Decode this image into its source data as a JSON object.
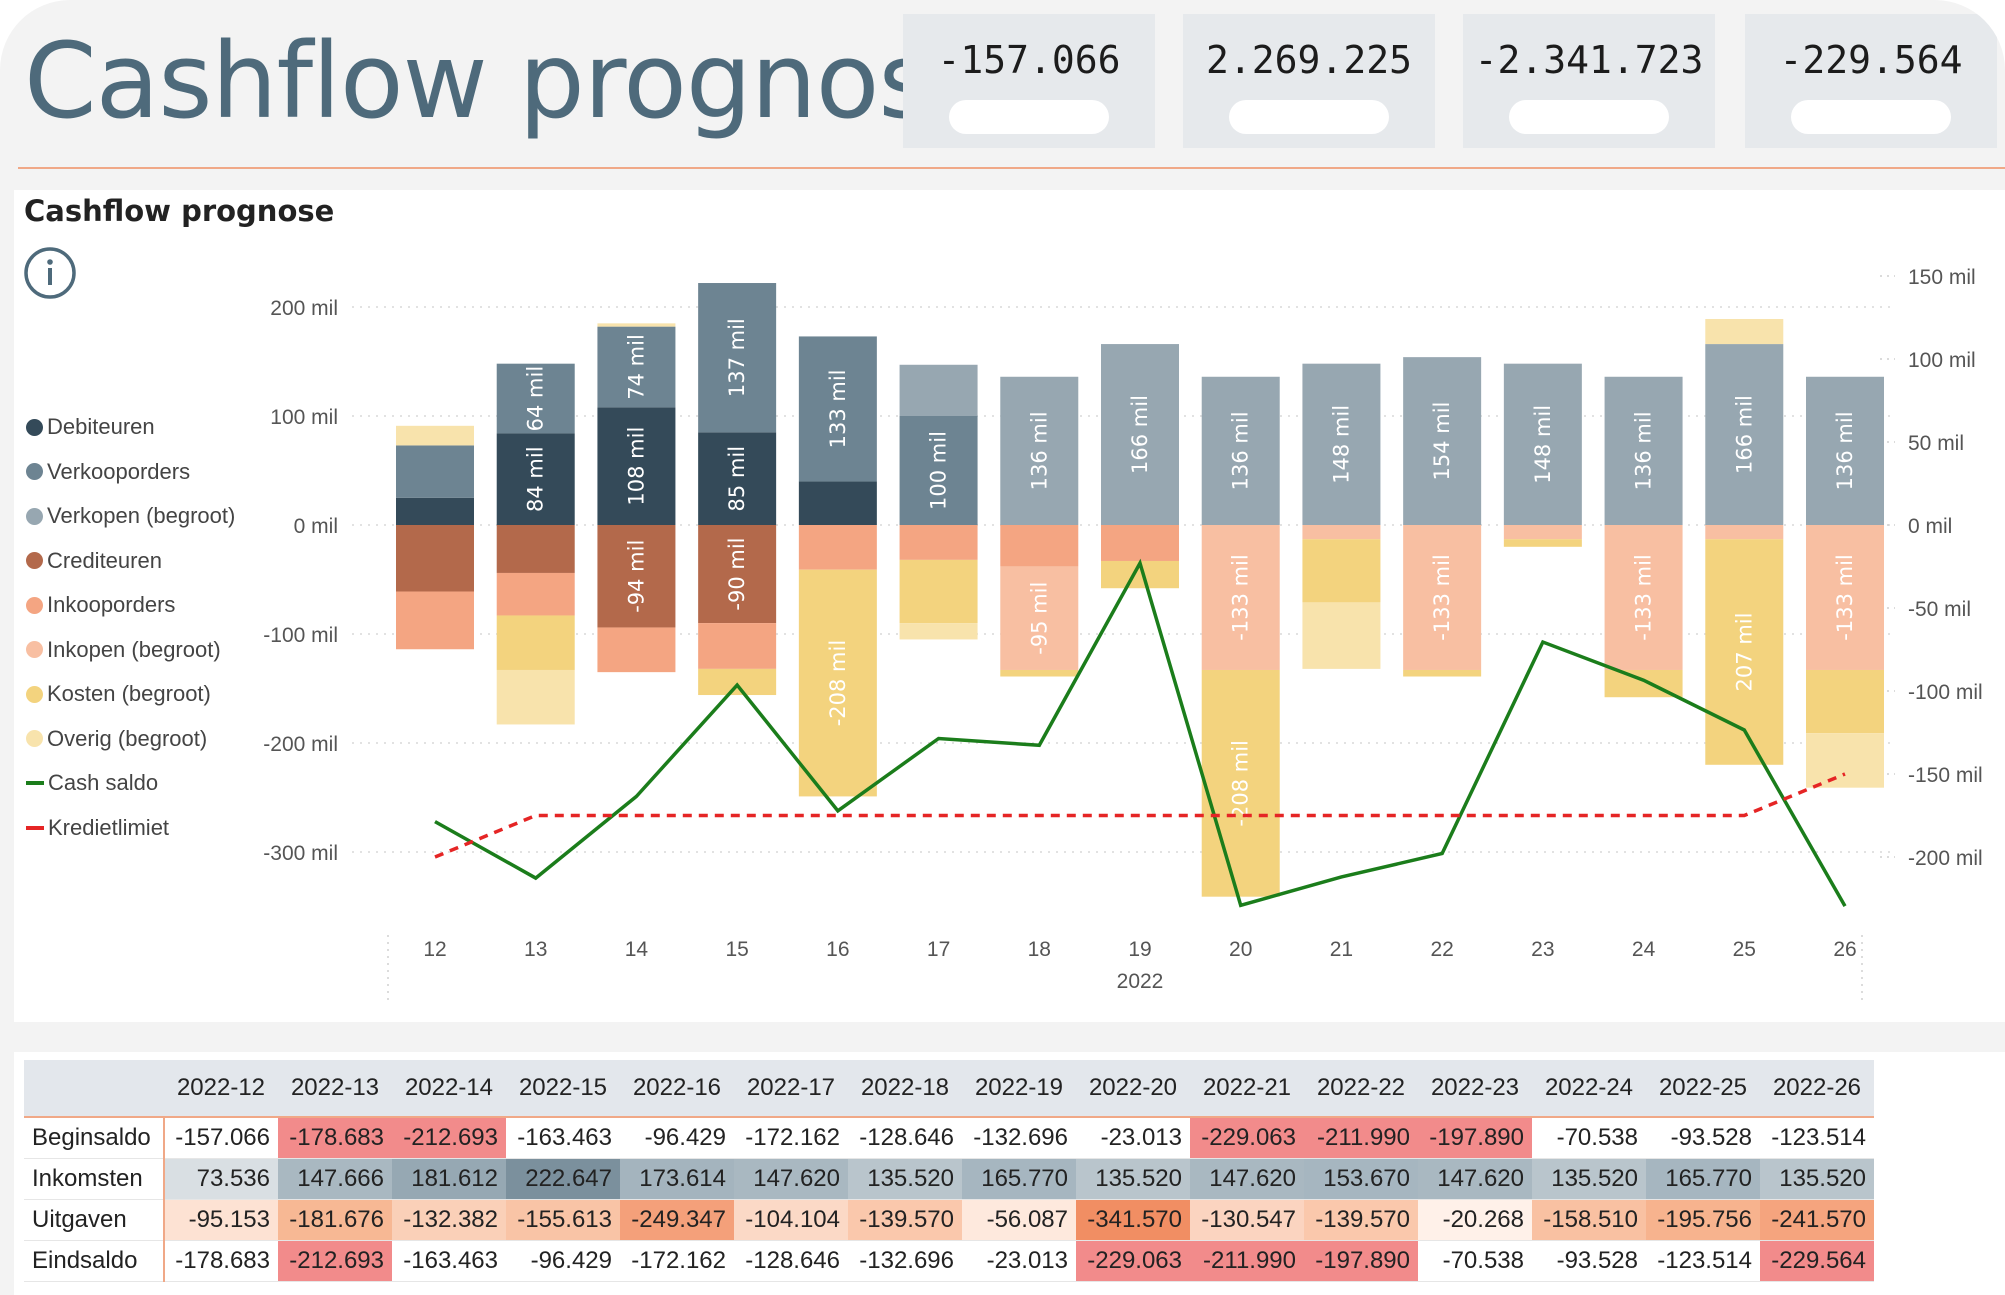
{
  "header": {
    "title": "Cashflow prognose",
    "kpis": [
      "-157.066",
      "2.269.225",
      "-2.341.723",
      "-229.564"
    ]
  },
  "chart_title": "Cashflow prognose",
  "chart_data": {
    "type": "bar",
    "stacked": true,
    "title": "Cashflow prognose",
    "year_label": "2022",
    "categories": [
      "12",
      "13",
      "14",
      "15",
      "16",
      "17",
      "18",
      "19",
      "20",
      "21",
      "22",
      "23",
      "24",
      "25",
      "26"
    ],
    "left_axis": {
      "ylim": [
        -350,
        230
      ],
      "ticks": [
        200,
        100,
        0,
        -100,
        -200,
        -300
      ],
      "tick_labels": [
        "200 mil",
        "100 mil",
        "0 mil",
        "-100 mil",
        "-200 mil",
        "-300 mil"
      ]
    },
    "right_axis": {
      "ylim": [
        -265,
        170
      ],
      "ticks": [
        150,
        100,
        50,
        0,
        -50,
        -100,
        -150,
        -200
      ],
      "tick_labels": [
        "150 mil",
        "100 mil",
        "50 mil",
        "0 mil",
        "-50 mil",
        "-100 mil",
        "-150 mil",
        "-200 mil"
      ]
    },
    "legend": [
      {
        "name": "Debiteuren",
        "color": "#344a59",
        "kind": "dot"
      },
      {
        "name": "Verkooporders",
        "color": "#6d8492",
        "kind": "dot"
      },
      {
        "name": "Verkopen (begroot)",
        "color": "#97a7b1",
        "kind": "dot"
      },
      {
        "name": "Crediteuren",
        "color": "#b3694b",
        "kind": "dot"
      },
      {
        "name": "Inkooporders",
        "color": "#f4a582",
        "kind": "dot"
      },
      {
        "name": "Inkopen (begroot)",
        "color": "#f8bfa2",
        "kind": "dot"
      },
      {
        "name": "Kosten (begroot)",
        "color": "#f3d37e",
        "kind": "dot"
      },
      {
        "name": "Overig (begroot)",
        "color": "#f8e3ac",
        "kind": "dot"
      },
      {
        "name": "Cash saldo",
        "color": "#1b7d1b",
        "kind": "line"
      },
      {
        "name": "Kredietlimiet",
        "color": "#e52525",
        "kind": "dash"
      }
    ],
    "series": [
      {
        "name": "Debiteuren",
        "color": "#344a59",
        "values": [
          25,
          84,
          108,
          85,
          40,
          0,
          0,
          0,
          0,
          0,
          0,
          0,
          0,
          0,
          0
        ],
        "labels": [
          "",
          "84 mil",
          "108 mil",
          "85 mil",
          "",
          "",
          "",
          "",
          "",
          "",
          "",
          "",
          "",
          "",
          ""
        ]
      },
      {
        "name": "Verkooporders",
        "color": "#6d8492",
        "values": [
          48,
          64,
          74,
          137,
          133,
          100,
          0,
          0,
          0,
          0,
          0,
          0,
          0,
          0,
          0
        ],
        "labels": [
          "",
          "64 mil",
          "74 mil",
          "137 mil",
          "133 mil",
          "100 mil",
          "",
          "",
          "",
          "",
          "",
          "",
          "",
          "",
          ""
        ]
      },
      {
        "name": "Verkopen (begroot)",
        "color": "#97a7b1",
        "values": [
          0,
          0,
          0,
          0,
          0,
          47,
          136,
          166,
          136,
          148,
          154,
          148,
          136,
          166,
          136
        ],
        "labels": [
          "",
          "",
          "",
          "",
          "",
          "",
          "136 mil",
          "166 mil",
          "136 mil",
          "148 mil",
          "154 mil",
          "148 mil",
          "136 mil",
          "166 mil",
          "136 mil"
        ]
      },
      {
        "name": "Crediteuren",
        "color": "#b3694b",
        "values": [
          -61,
          -44,
          -94,
          -90,
          0,
          0,
          0,
          0,
          0,
          0,
          0,
          0,
          0,
          0,
          0
        ],
        "labels": [
          "",
          "",
          "-94 mil",
          "-90 mil",
          "",
          "",
          "",
          "",
          "",
          "",
          "",
          "",
          "",
          "",
          ""
        ]
      },
      {
        "name": "Inkooporders",
        "color": "#f4a582",
        "values": [
          -53,
          -39,
          -41,
          -42,
          -41,
          -32,
          -38,
          -33,
          0,
          0,
          0,
          0,
          0,
          0,
          0
        ],
        "labels": [
          "",
          "",
          "",
          "",
          "",
          "",
          "",
          "",
          "",
          "",
          "",
          "",
          "",
          "",
          ""
        ]
      },
      {
        "name": "Inkopen (begroot)",
        "color": "#f8bfa2",
        "values": [
          0,
          0,
          0,
          0,
          0,
          0,
          -95,
          0,
          -133,
          -13,
          -133,
          -13,
          -133,
          -13,
          -133
        ],
        "labels": [
          "",
          "",
          "",
          "",
          "",
          "",
          "-95 mil",
          "",
          "-133 mil",
          "",
          "-133 mil",
          "",
          "-133 mil",
          "",
          "-133 mil"
        ]
      },
      {
        "name": "Kosten (begroot)",
        "color": "#f3d37e",
        "values": [
          0,
          -50,
          0,
          -24,
          -208,
          -58,
          -6,
          -25,
          -208,
          -58,
          -6,
          -7,
          -25,
          -207,
          -58
        ],
        "labels": [
          "",
          "",
          "",
          "",
          "-208 mil",
          "",
          "",
          "",
          "-208 mil",
          "",
          "",
          "",
          "",
          "207 mil",
          ""
        ]
      },
      {
        "name": "Overig (begroot)",
        "color": "#f8e3ac",
        "values": [
          18,
          -50,
          3,
          0,
          0,
          -15,
          0,
          0,
          0,
          -61,
          0,
          0,
          0,
          23,
          -50
        ],
        "labels": [
          "",
          "",
          "",
          "",
          "",
          "",
          "",
          "",
          "",
          "",
          "",
          "",
          "",
          "",
          ""
        ]
      }
    ],
    "lines": [
      {
        "name": "Cash saldo",
        "axis": "right",
        "color": "#1b7d1b",
        "values": [
          -178.7,
          -212.7,
          -163.5,
          -96.4,
          -172.2,
          -128.6,
          -132.7,
          -23.0,
          -229.1,
          -212.0,
          -197.9,
          -70.5,
          -93.5,
          -123.5,
          -229.6
        ]
      },
      {
        "name": "Kredietlimiet",
        "axis": "right",
        "color": "#e52525",
        "dashed": true,
        "values": [
          -200,
          -175,
          -175,
          -175,
          -175,
          -175,
          -175,
          -175,
          -175,
          -175,
          -175,
          -175,
          -175,
          -175,
          -150
        ]
      }
    ]
  },
  "table": {
    "columns": [
      "2022-12",
      "2022-13",
      "2022-14",
      "2022-15",
      "2022-16",
      "2022-17",
      "2022-18",
      "2022-19",
      "2022-20",
      "2022-21",
      "2022-22",
      "2022-23",
      "2022-24",
      "2022-25",
      "2022-26"
    ],
    "rows": [
      {
        "label": "Beginsaldo",
        "values": [
          "-157.066",
          "-178.683",
          "-212.693",
          "-163.463",
          "-96.429",
          "-172.162",
          "-128.646",
          "-132.696",
          "-23.013",
          "-229.063",
          "-211.990",
          "-197.890",
          "-70.538",
          "-93.528",
          "-123.514"
        ]
      },
      {
        "label": "Inkomsten",
        "values": [
          "73.536",
          "147.666",
          "181.612",
          "222.647",
          "173.614",
          "147.620",
          "135.520",
          "165.770",
          "135.520",
          "147.620",
          "153.670",
          "147.620",
          "135.520",
          "165.770",
          "135.520"
        ]
      },
      {
        "label": "Uitgaven",
        "values": [
          "-95.153",
          "-181.676",
          "-132.382",
          "-155.613",
          "-249.347",
          "-104.104",
          "-139.570",
          "-56.087",
          "-341.570",
          "-130.547",
          "-139.570",
          "-20.268",
          "-158.510",
          "-195.756",
          "-241.570"
        ]
      },
      {
        "label": "Eindsaldo",
        "values": [
          "-178.683",
          "-212.693",
          "-163.463",
          "-96.429",
          "-172.162",
          "-128.646",
          "-132.696",
          "-23.013",
          "-229.063",
          "-211.990",
          "-197.890",
          "-70.538",
          "-93.528",
          "-123.514",
          "-229.564"
        ]
      }
    ],
    "cell_colors": [
      [
        "#ffffff",
        "#f28b8b",
        "#f28b8b",
        "#ffffff",
        "#ffffff",
        "#ffffff",
        "#ffffff",
        "#ffffff",
        "#ffffff",
        "#f28b8b",
        "#f28b8b",
        "#f28b8b",
        "#ffffff",
        "#ffffff",
        "#ffffff"
      ],
      [
        "#d9dfe3",
        "#a9b8c1",
        "#96a8b3",
        "#7b909d",
        "#a4b4be",
        "#a9b8c1",
        "#b9c5cc",
        "#a6b6c0",
        "#b9c5cc",
        "#a9b8c1",
        "#a6b6c0",
        "#a9b8c1",
        "#b9c5cc",
        "#a6b6c0",
        "#b9c5cc"
      ],
      [
        "#fde2d3",
        "#f7b894",
        "#fad0b8",
        "#f9c4a6",
        "#f4a07a",
        "#fbd9c6",
        "#fac8ac",
        "#fee9dd",
        "#f18e63",
        "#fbd4c0",
        "#fac8ac",
        "#fff1e9",
        "#f9c1a2",
        "#f7b38e",
        "#f5a47e"
      ],
      [
        "#ffffff",
        "#f28b8b",
        "#ffffff",
        "#ffffff",
        "#ffffff",
        "#ffffff",
        "#ffffff",
        "#ffffff",
        "#f28b8b",
        "#f28b8b",
        "#f28b8b",
        "#ffffff",
        "#ffffff",
        "#ffffff",
        "#f28b8b"
      ]
    ]
  }
}
